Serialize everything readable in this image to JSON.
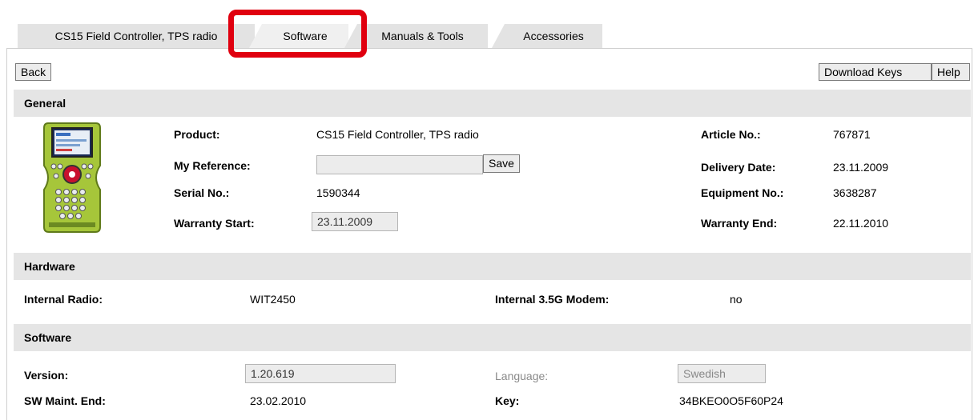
{
  "tabs": [
    {
      "label": "CS15 Field Controller, TPS radio"
    },
    {
      "label": "Software",
      "active": true
    },
    {
      "label": "Manuals & Tools"
    },
    {
      "label": "Accessories"
    }
  ],
  "toolbar": {
    "back_label": "Back",
    "download_keys_label": "Download Keys",
    "help_label": "Help"
  },
  "general": {
    "title": "General",
    "product_label": "Product:",
    "product_value": "CS15 Field Controller, TPS radio",
    "my_reference_label": "My Reference:",
    "my_reference_value": "",
    "save_label": "Save",
    "serial_label": "Serial No.:",
    "serial_value": "1590344",
    "warranty_start_label": "Warranty Start:",
    "warranty_start_value": "23.11.2009",
    "article_label": "Article No.:",
    "article_value": "767871",
    "delivery_label": "Delivery Date:",
    "delivery_value": "23.11.2009",
    "equipment_label": "Equipment No.:",
    "equipment_value": "3638287",
    "warranty_end_label": "Warranty End:",
    "warranty_end_value": "22.11.2010"
  },
  "hardware": {
    "title": "Hardware",
    "radio_label": "Internal Radio:",
    "radio_value": "WIT2450",
    "modem_label": "Internal 3.5G Modem:",
    "modem_value": "no"
  },
  "software": {
    "title": "Software",
    "version_label": "Version:",
    "version_value": "1.20.619",
    "language_label": "Language:",
    "language_value": "Swedish",
    "maint_end_label": "SW Maint. End:",
    "maint_end_value": "23.02.2010",
    "key_label": "Key:",
    "key_value": "34BKEO0O5F60P24"
  },
  "colors": {
    "highlight": "#e0000f",
    "section_bg": "#e5e5e5",
    "tab_bg": "#e3e3e3",
    "device_green": "#a6c63a"
  }
}
